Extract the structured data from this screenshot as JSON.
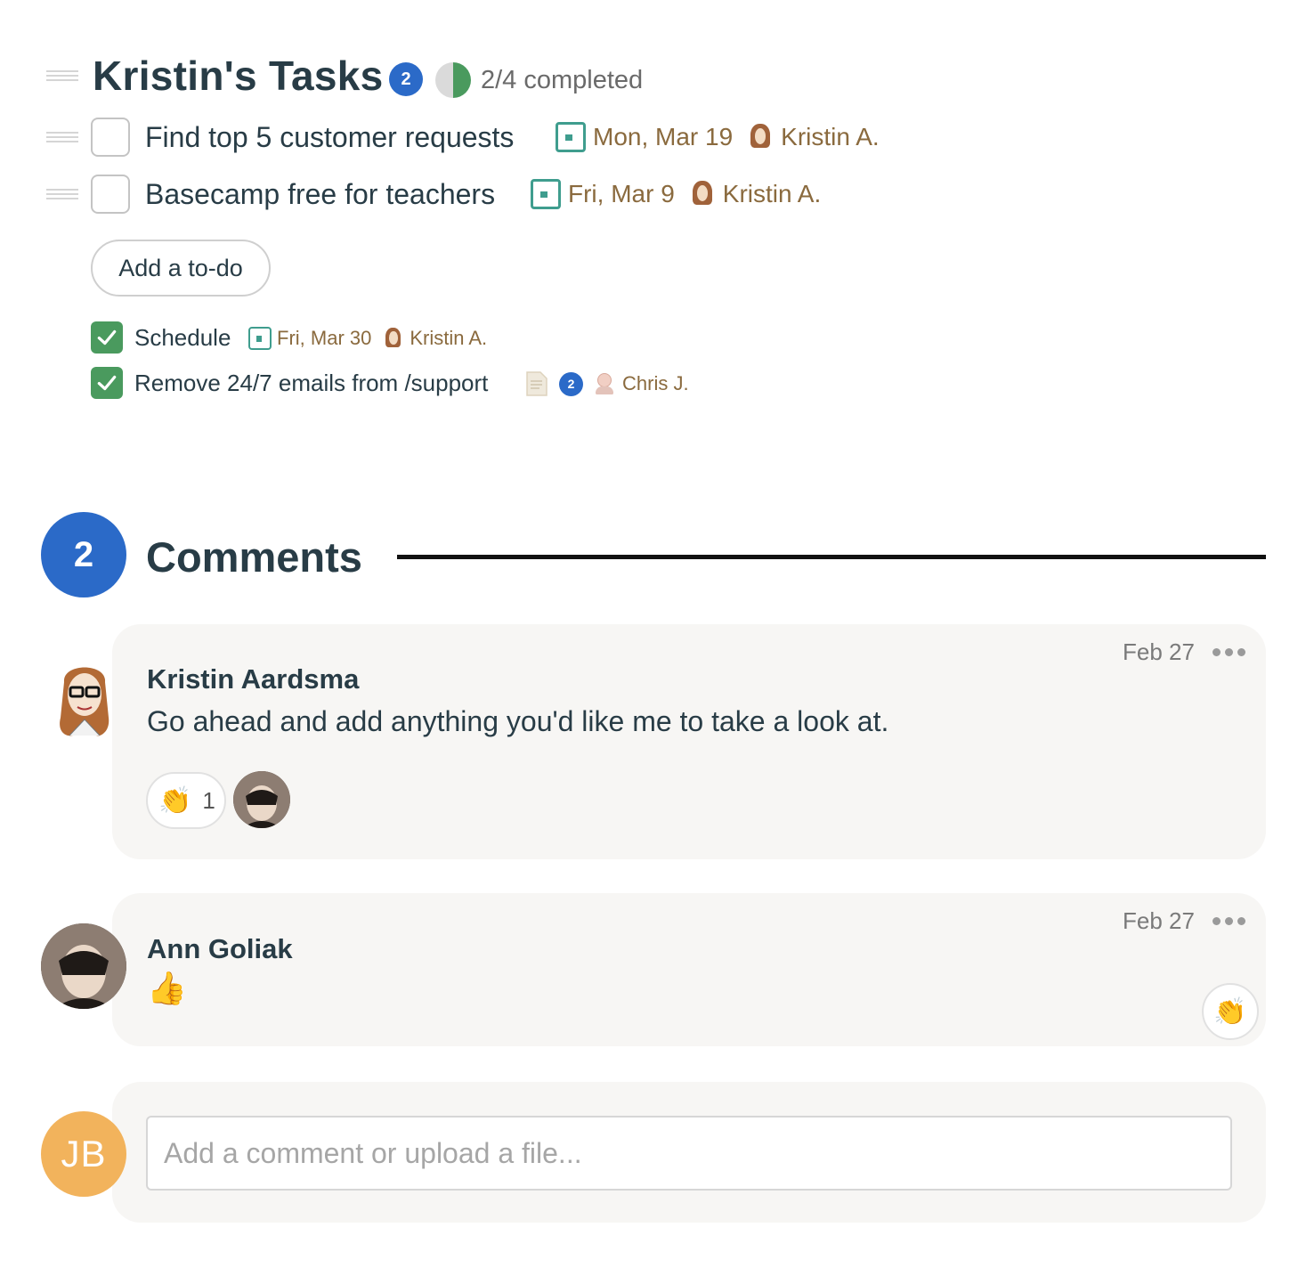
{
  "todolist": {
    "title": "Kristin's Tasks",
    "comment_count": "2",
    "progress_text": "2/4 completed",
    "progress_fraction": 0.5
  },
  "todos": [
    {
      "text": "Find top 5 customer requests",
      "due": "Mon, Mar 19",
      "assignee": "Kristin A."
    },
    {
      "text": "Basecamp free for teachers",
      "due": "Fri, Mar 9",
      "assignee": "Kristin A."
    }
  ],
  "add_todo_label": "Add a to-do",
  "completed": [
    {
      "text": "Schedule",
      "due": "Fri, Mar 30",
      "assignee": "Kristin A."
    },
    {
      "text": "Remove 24/7 emails from /support",
      "comments": "2",
      "assignee": "Chris J."
    }
  ],
  "comments_section": {
    "count": "2",
    "title": "Comments"
  },
  "comments": [
    {
      "author": "Kristin Aardsma",
      "date": "Feb 27",
      "body": "Go ahead and add anything you'd like me to take a look at.",
      "boost_emoji": "👏",
      "boost_count": "1"
    },
    {
      "author": "Ann Goliak",
      "date": "Feb 27",
      "body": "👍",
      "boost_emoji": "👏"
    }
  ],
  "composer": {
    "avatar_initials": "JB",
    "placeholder": "Add a comment or upload a file..."
  },
  "colors": {
    "badge_blue": "#2b6ac8",
    "check_green": "#4a9a5e",
    "calendar_teal": "#3f9d8e",
    "meta_brown": "#8a6a3e",
    "avatar_orange": "#f2b35c",
    "card_bg": "#f7f6f4"
  }
}
